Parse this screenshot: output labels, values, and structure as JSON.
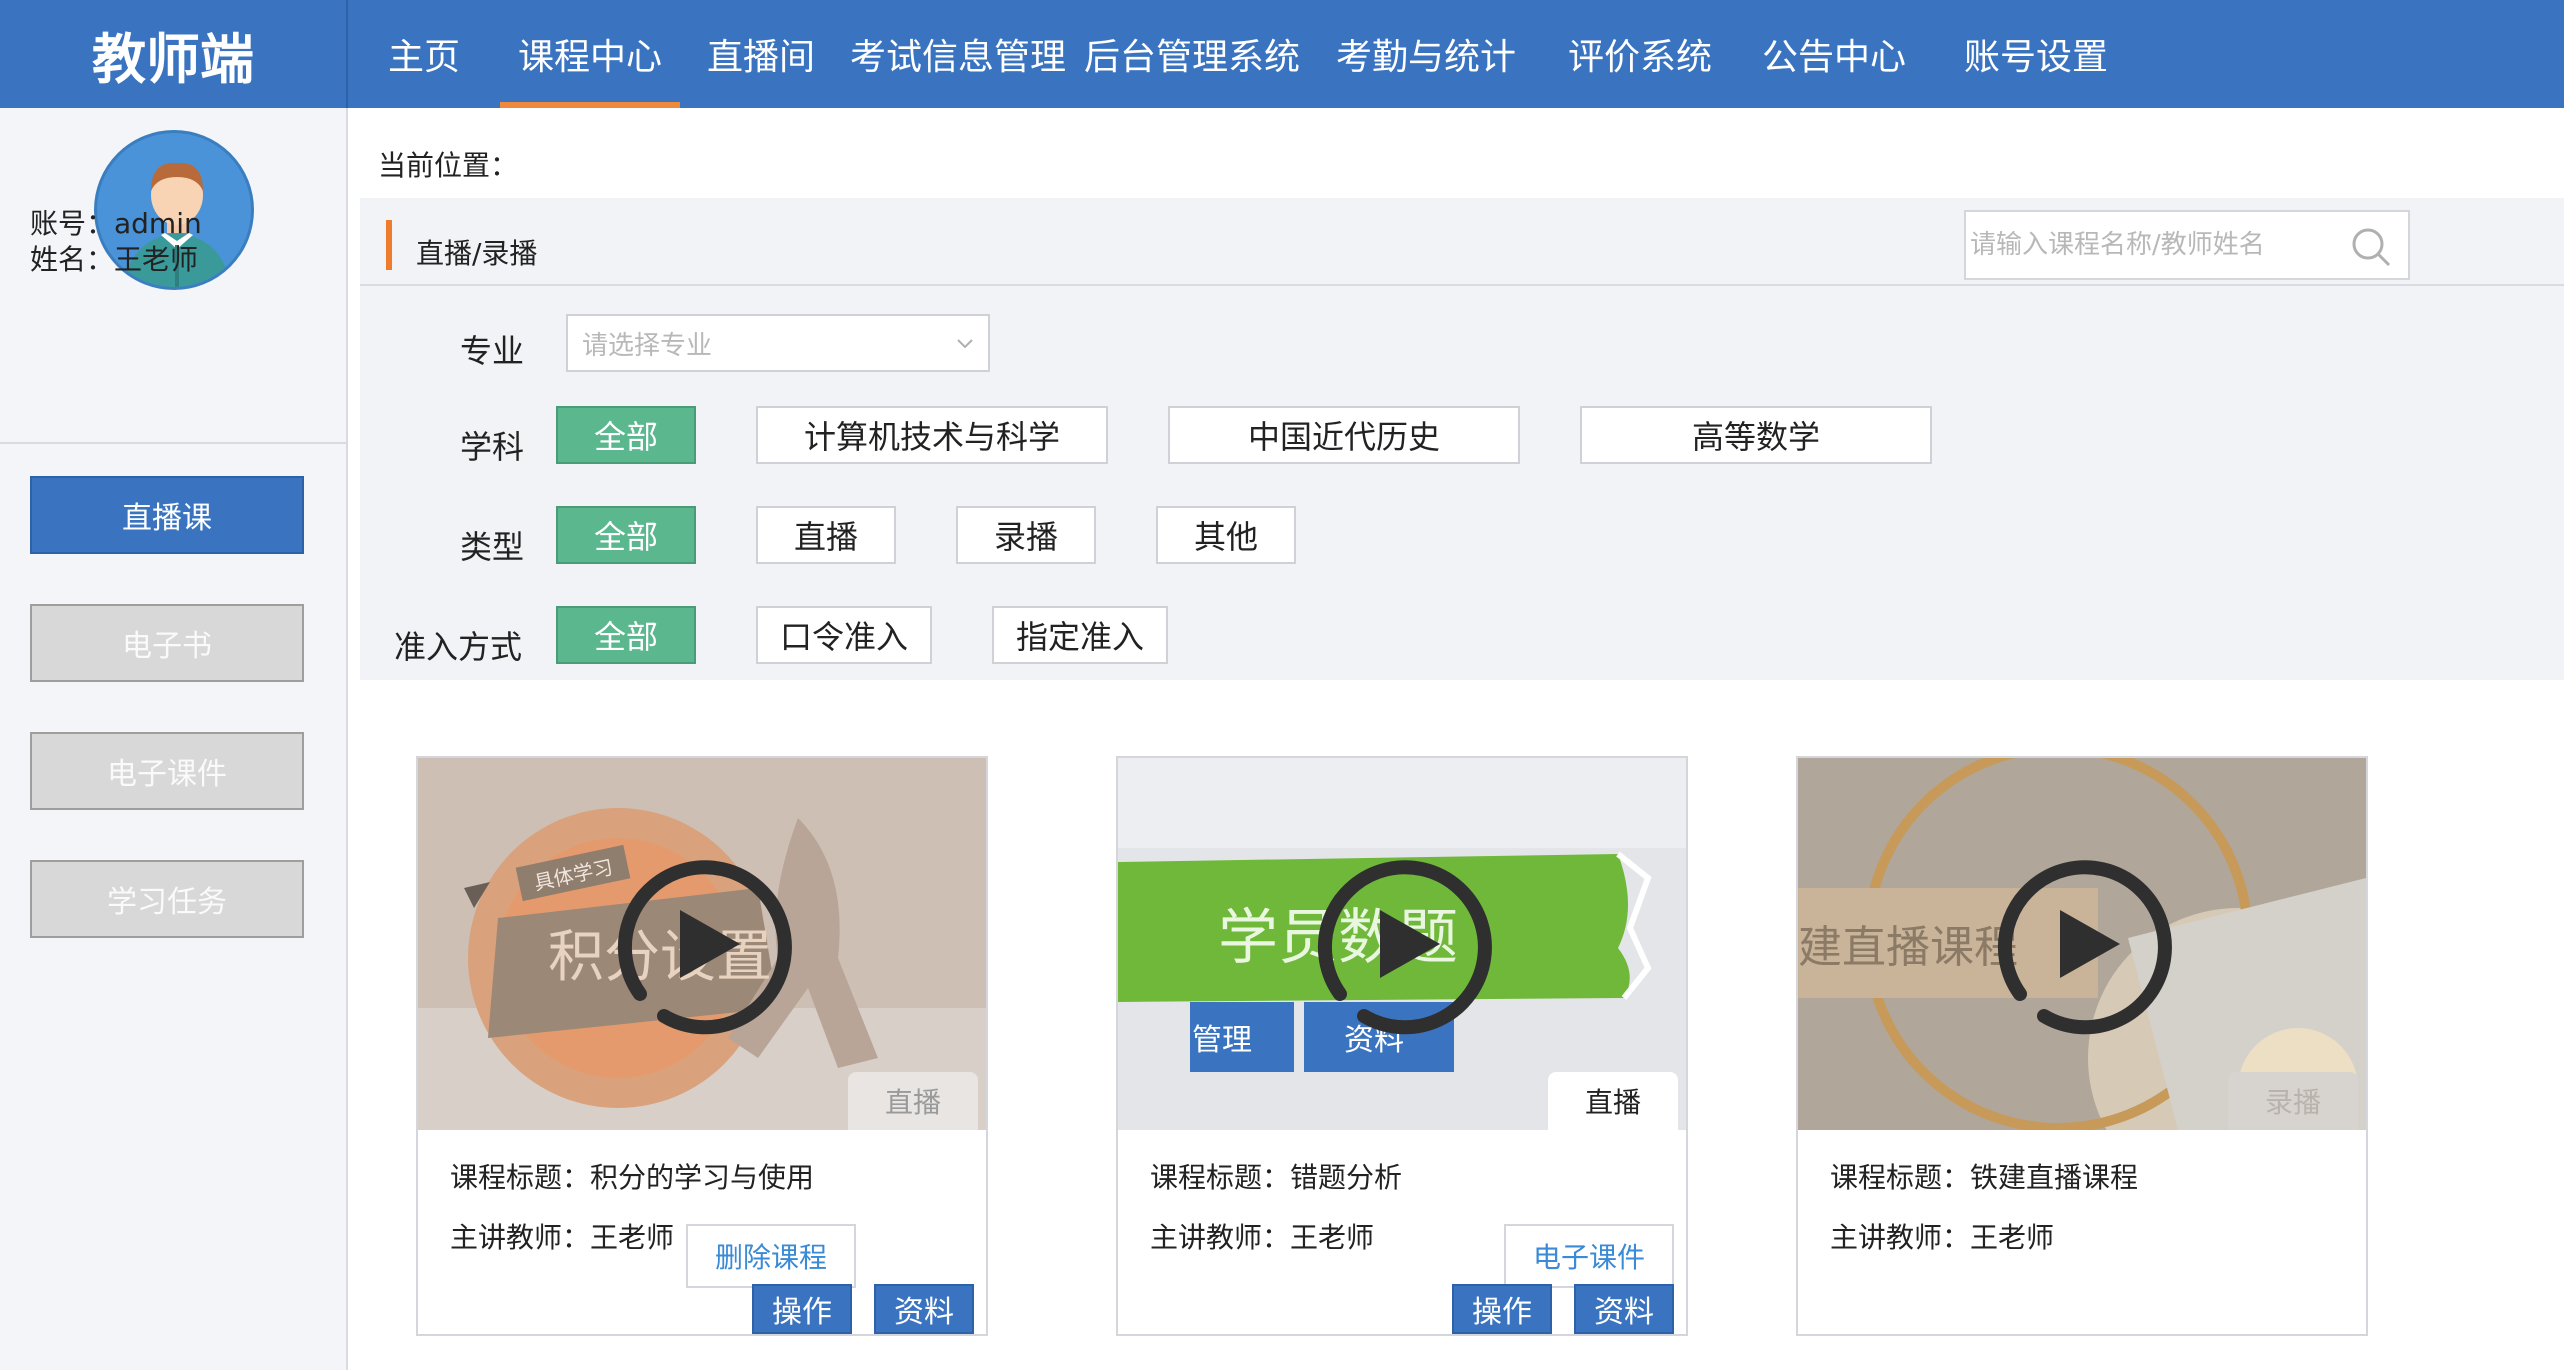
{
  "app": {
    "brand": "教师端"
  },
  "nav": {
    "items": [
      {
        "label": "主页",
        "active": false
      },
      {
        "label": "课程中心",
        "active": true
      },
      {
        "label": "直播间",
        "active": false
      },
      {
        "label": "考试信息管理",
        "active": false
      },
      {
        "label": "后台管理系统",
        "active": false
      },
      {
        "label": "考勤与统计",
        "active": false
      },
      {
        "label": "评价系统",
        "active": false
      },
      {
        "label": "公告中心",
        "active": false
      },
      {
        "label": "账号设置",
        "active": false
      }
    ]
  },
  "sidebar": {
    "account_label": "账号：admin",
    "name_label": "姓名：王老师",
    "buttons": [
      {
        "label": "直播课",
        "active": true
      },
      {
        "label": "电子书",
        "active": false
      },
      {
        "label": "电子课件",
        "active": false
      },
      {
        "label": "学习任务",
        "active": false
      }
    ]
  },
  "breadcrumb": {
    "label": "当前位置："
  },
  "panel": {
    "title": "直播/录播",
    "search_placeholder": "请输入课程名称/教师姓名",
    "major": {
      "label": "专业",
      "placeholder": "请选择专业"
    },
    "subject": {
      "label": "学科",
      "options": [
        "全部",
        "计算机技术与科学",
        "中国近代历史",
        "高等数学"
      ],
      "selected": 0
    },
    "type": {
      "label": "类型",
      "options": [
        "全部",
        "直播",
        "录播",
        "其他"
      ],
      "selected": 0
    },
    "access": {
      "label": "准入方式",
      "options": [
        "全部",
        "口令准入",
        "指定准入"
      ],
      "selected": 0
    }
  },
  "courses": [
    {
      "thumb_badge": "具体学习",
      "thumb_text": "积分设置",
      "type": "直播",
      "title": "课程标题：积分的学习与使用",
      "teacher": "主讲教师：王老师",
      "link_button": "删除课程",
      "actions": [
        "操作",
        "资料"
      ]
    },
    {
      "thumb_text": "学员数题",
      "thumb_btn1": "管理",
      "thumb_btn2": "资料",
      "type": "直播",
      "title": "课程标题：错题分析",
      "teacher": "主讲教师：王老师",
      "link_button": "电子课件",
      "actions": [
        "操作",
        "资料"
      ]
    },
    {
      "thumb_text": "建直播课程",
      "type": "录播",
      "title": "课程标题：铁建直播课程",
      "teacher": "主讲教师：王老师"
    }
  ],
  "colors": {
    "primary": "#3a74c0",
    "accent": "#ef8a3c",
    "chip_active": "#5bb88e",
    "link": "#3a8ad6"
  }
}
